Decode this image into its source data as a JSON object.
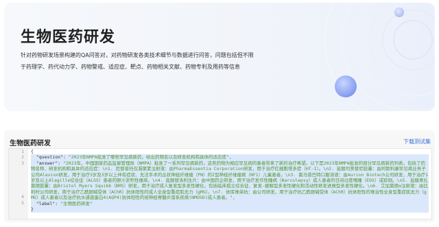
{
  "hero": {
    "title": "生物医药研发",
    "description": "针对药物研发场景构建的QA问答对，对药物研发各类技术细节与数据进行问答，问题包括但不限于药理学、药代动力学、药物警戒、适应症、靶点、药物相关文献、药物专利及用药等信息"
  },
  "panel": {
    "title": "生物医药研发",
    "download_label": "下载测试集"
  },
  "code": {
    "line_numbers": [
      "1",
      "2",
      "3",
      "4",
      "5"
    ],
    "open_brace": "{",
    "question_key": "\"question\": ",
    "question_value": "\"2023年NMPA批准了哪些罕见病新药，给出药物名以及研发机构和具体的适应症\",",
    "answer_key": "\"answer\": ",
    "answer_value": "\"2023年，中国国家药品监督管理局（NMPA）批准了一系列罕见病新药，这些药物为相应罕见病的患者带来了新的治疗希望。以下是2023年NMPA批准的部分罕见病新药列表，包括了药物名称、研发机构和具体的适应症：\\n1. 厄替普托仅凝聚素注射液：由PharmaEssentia Corporation研发，用于治疗红细胞增多症（HT-1）。\\n2. 盐酸司美替尼胶囊：由阿斯利康罕见病业务子公司Alexion研发，用于治疗3岁及3岁以上伴有症状、无法手术的丛状神经纤维瘤（PN）的I型神经纤维瘤病（NF1）儿童患者。\\n3. 氯马昔巴特口服溶液：由Aurion Biotech公司研发，用于治疗1岁及以上Alagille综合征（ALGS）患者的胆汁淤积性瘙痒。\\n4. 盐酸替洛利生片：由中国药企研发，用于治疗发作性睡病（Narcolepsy）成人患者的日间过度嗜睡（EDS）或猝倒。\\n5. 盐酸奥扎莫德胶囊：由Bristol Myers Squibb（BMS）研发，用于治疗成人复发型多发性硬化，包括临床孤立综合征、复发-缓解型多发性硬化和活动性继发进展型多发性硬化。\\n6. 艾加莫德α注射液：由比利时公司研发，用于治疗乙酰胆碱受体（AChR）抗体阳性的成人全身型重症肌无力（gMG）。\\n7. 依库珠单抗：由公司研发，用于治疗抗乙酰胆碱受体（AChR）抗体阳性的难治性全身型重症肌无力（gMG）成人患者以及治疗抗水通道蛋白4(AQP4)抗体阳性的视神经脊髓炎谱系疾病(NMOSD)成人患者。\",",
    "label_key": "\"label\": ",
    "label_value": "\"生物医药研发\"",
    "close_brace": "}"
  }
}
